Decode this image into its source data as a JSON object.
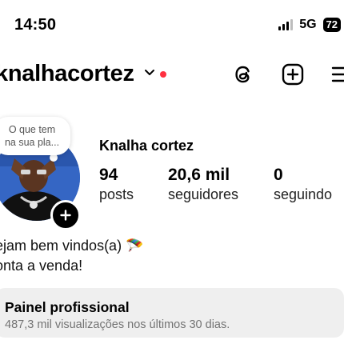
{
  "status_bar": {
    "time": "14:50",
    "network": "5G",
    "battery": "72"
  },
  "header": {
    "username": "knalhacortez",
    "icons": [
      "threads-icon",
      "plus-square-icon",
      "menu-icon"
    ],
    "notification_dot_color": "#ff3040"
  },
  "profile": {
    "note_text_line1": "O que tem",
    "note_text_line2": "na sua pla...",
    "display_name": "Knalha cortez",
    "stats": [
      {
        "value": "94",
        "label": "posts"
      },
      {
        "value": "20,6 mil",
        "label": "seguidores"
      },
      {
        "value": "0",
        "label": "seguindo"
      }
    ],
    "bio_line1": "ejam bem vindos(a) 🪂",
    "bio_line2": "onta a venda!"
  },
  "professional_panel": {
    "title": "Painel profissional",
    "subtitle": "487,3 mil visualizações nos últimos 30 dias."
  }
}
